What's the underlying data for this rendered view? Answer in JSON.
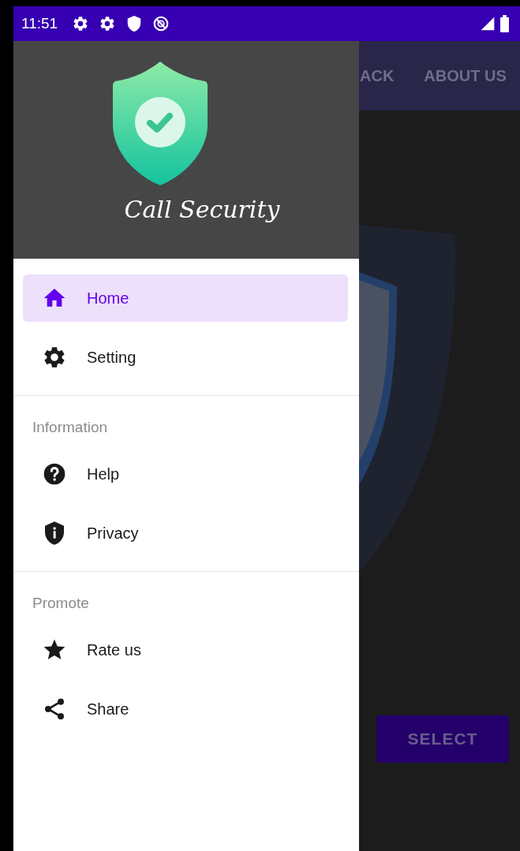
{
  "status_bar": {
    "time": "11:51"
  },
  "drawer": {
    "app_name": "Call Security",
    "sections": [
      {
        "items": [
          {
            "kind": "home",
            "label": "Home",
            "selected": true
          },
          {
            "kind": "settings",
            "label": "Setting",
            "selected": false
          }
        ]
      },
      {
        "title": "Information",
        "items": [
          {
            "kind": "help",
            "label": "Help",
            "selected": false
          },
          {
            "kind": "privacy",
            "label": "Privacy",
            "selected": false
          }
        ]
      },
      {
        "title": "Promote",
        "items": [
          {
            "kind": "rate",
            "label": "Rate us",
            "selected": false
          },
          {
            "kind": "share",
            "label": "Share",
            "selected": false
          }
        ]
      }
    ]
  },
  "app_bar": {
    "tabs": [
      "ACK",
      "ABOUT US"
    ]
  },
  "main": {
    "button": "SELECT"
  }
}
